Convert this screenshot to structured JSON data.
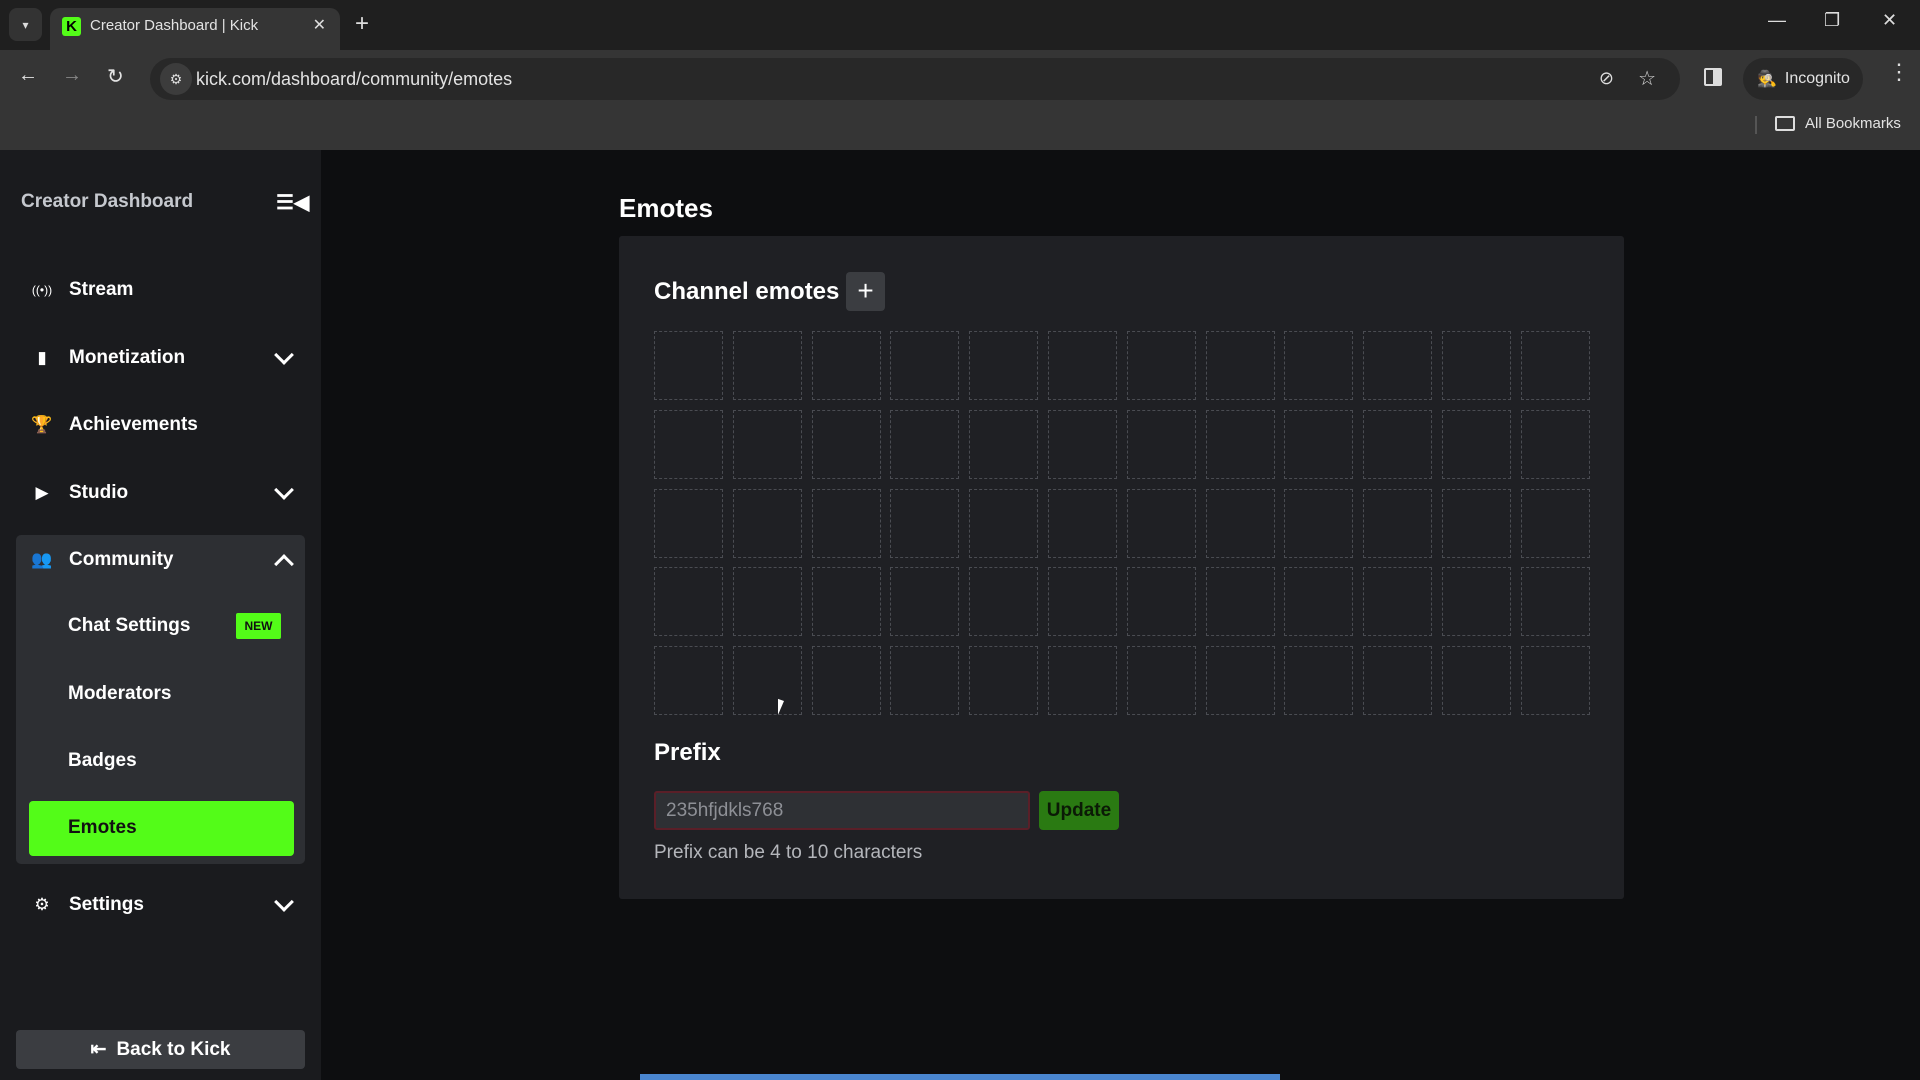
{
  "browser": {
    "tab_title": "Creator Dashboard | Kick",
    "favicon_letter": "K",
    "url": "kick.com/dashboard/community/emotes",
    "incognito_label": "Incognito",
    "bookmarks_label": "All Bookmarks",
    "icons": {
      "tab_list": "▾",
      "close_tab": "✕",
      "new_tab": "+",
      "minimize": "—",
      "maximize": "❐",
      "close_window": "✕",
      "back": "←",
      "forward": "→",
      "reload": "↻",
      "site_info": "⚙",
      "eye_off": "⊘",
      "star": "☆",
      "incognito": "🕵",
      "menu": "⋮"
    }
  },
  "sidebar": {
    "title": "Creator Dashboard",
    "collapse_icon": "☰◀",
    "items": [
      {
        "label": "Stream",
        "icon": "((•))"
      },
      {
        "label": "Monetization",
        "icon": "▮"
      },
      {
        "label": "Achievements",
        "icon": "🏆"
      },
      {
        "label": "Studio",
        "icon": "▶"
      },
      {
        "label": "Community",
        "icon": "👥"
      },
      {
        "label": "Settings",
        "icon": "⚙"
      }
    ],
    "community_sub": [
      {
        "label": "Chat Settings",
        "badge": "NEW"
      },
      {
        "label": "Moderators"
      },
      {
        "label": "Badges"
      },
      {
        "label": "Emotes"
      }
    ],
    "back_label": "Back to Kick",
    "back_icon": "⇤"
  },
  "main": {
    "title": "Emotes",
    "channel_emotes_title": "Channel emotes",
    "add_emote_icon": "+",
    "grid": {
      "columns": 12,
      "rows": 5
    },
    "prefix_title": "Prefix",
    "prefix_value": "235hfjdkls768",
    "update_label": "Update",
    "prefix_help": "Prefix can be 4 to 10 characters"
  },
  "colors": {
    "accent": "#53fc18",
    "update_button": "#2a7a12",
    "invalid_border": "#5a1f28"
  }
}
